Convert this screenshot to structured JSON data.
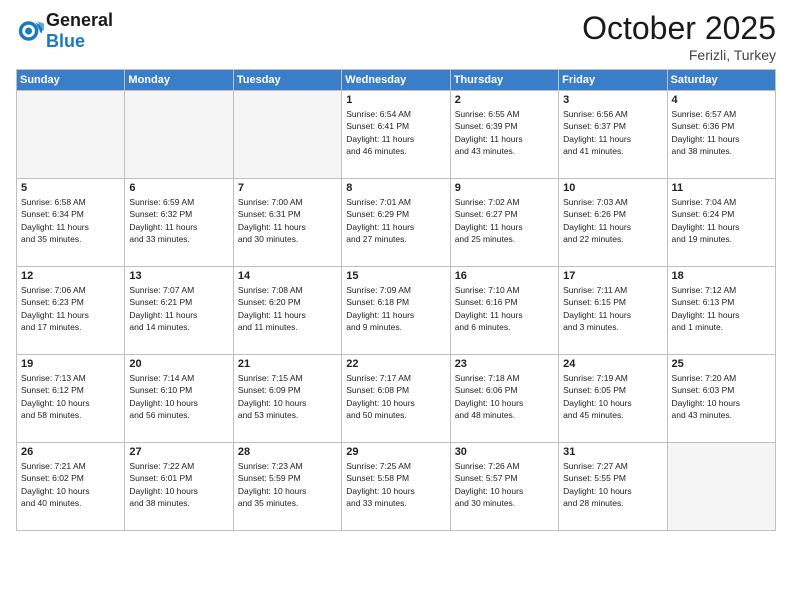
{
  "header": {
    "logo_general": "General",
    "logo_blue": "Blue",
    "month": "October 2025",
    "location": "Ferizli, Turkey"
  },
  "weekdays": [
    "Sunday",
    "Monday",
    "Tuesday",
    "Wednesday",
    "Thursday",
    "Friday",
    "Saturday"
  ],
  "weeks": [
    [
      {
        "day": "",
        "info": "",
        "empty": true
      },
      {
        "day": "",
        "info": "",
        "empty": true
      },
      {
        "day": "",
        "info": "",
        "empty": true
      },
      {
        "day": "1",
        "info": "Sunrise: 6:54 AM\nSunset: 6:41 PM\nDaylight: 11 hours\nand 46 minutes.",
        "empty": false
      },
      {
        "day": "2",
        "info": "Sunrise: 6:55 AM\nSunset: 6:39 PM\nDaylight: 11 hours\nand 43 minutes.",
        "empty": false
      },
      {
        "day": "3",
        "info": "Sunrise: 6:56 AM\nSunset: 6:37 PM\nDaylight: 11 hours\nand 41 minutes.",
        "empty": false
      },
      {
        "day": "4",
        "info": "Sunrise: 6:57 AM\nSunset: 6:36 PM\nDaylight: 11 hours\nand 38 minutes.",
        "empty": false
      }
    ],
    [
      {
        "day": "5",
        "info": "Sunrise: 6:58 AM\nSunset: 6:34 PM\nDaylight: 11 hours\nand 35 minutes.",
        "empty": false
      },
      {
        "day": "6",
        "info": "Sunrise: 6:59 AM\nSunset: 6:32 PM\nDaylight: 11 hours\nand 33 minutes.",
        "empty": false
      },
      {
        "day": "7",
        "info": "Sunrise: 7:00 AM\nSunset: 6:31 PM\nDaylight: 11 hours\nand 30 minutes.",
        "empty": false
      },
      {
        "day": "8",
        "info": "Sunrise: 7:01 AM\nSunset: 6:29 PM\nDaylight: 11 hours\nand 27 minutes.",
        "empty": false
      },
      {
        "day": "9",
        "info": "Sunrise: 7:02 AM\nSunset: 6:27 PM\nDaylight: 11 hours\nand 25 minutes.",
        "empty": false
      },
      {
        "day": "10",
        "info": "Sunrise: 7:03 AM\nSunset: 6:26 PM\nDaylight: 11 hours\nand 22 minutes.",
        "empty": false
      },
      {
        "day": "11",
        "info": "Sunrise: 7:04 AM\nSunset: 6:24 PM\nDaylight: 11 hours\nand 19 minutes.",
        "empty": false
      }
    ],
    [
      {
        "day": "12",
        "info": "Sunrise: 7:06 AM\nSunset: 6:23 PM\nDaylight: 11 hours\nand 17 minutes.",
        "empty": false
      },
      {
        "day": "13",
        "info": "Sunrise: 7:07 AM\nSunset: 6:21 PM\nDaylight: 11 hours\nand 14 minutes.",
        "empty": false
      },
      {
        "day": "14",
        "info": "Sunrise: 7:08 AM\nSunset: 6:20 PM\nDaylight: 11 hours\nand 11 minutes.",
        "empty": false
      },
      {
        "day": "15",
        "info": "Sunrise: 7:09 AM\nSunset: 6:18 PM\nDaylight: 11 hours\nand 9 minutes.",
        "empty": false
      },
      {
        "day": "16",
        "info": "Sunrise: 7:10 AM\nSunset: 6:16 PM\nDaylight: 11 hours\nand 6 minutes.",
        "empty": false
      },
      {
        "day": "17",
        "info": "Sunrise: 7:11 AM\nSunset: 6:15 PM\nDaylight: 11 hours\nand 3 minutes.",
        "empty": false
      },
      {
        "day": "18",
        "info": "Sunrise: 7:12 AM\nSunset: 6:13 PM\nDaylight: 11 hours\nand 1 minute.",
        "empty": false
      }
    ],
    [
      {
        "day": "19",
        "info": "Sunrise: 7:13 AM\nSunset: 6:12 PM\nDaylight: 10 hours\nand 58 minutes.",
        "empty": false
      },
      {
        "day": "20",
        "info": "Sunrise: 7:14 AM\nSunset: 6:10 PM\nDaylight: 10 hours\nand 56 minutes.",
        "empty": false
      },
      {
        "day": "21",
        "info": "Sunrise: 7:15 AM\nSunset: 6:09 PM\nDaylight: 10 hours\nand 53 minutes.",
        "empty": false
      },
      {
        "day": "22",
        "info": "Sunrise: 7:17 AM\nSunset: 6:08 PM\nDaylight: 10 hours\nand 50 minutes.",
        "empty": false
      },
      {
        "day": "23",
        "info": "Sunrise: 7:18 AM\nSunset: 6:06 PM\nDaylight: 10 hours\nand 48 minutes.",
        "empty": false
      },
      {
        "day": "24",
        "info": "Sunrise: 7:19 AM\nSunset: 6:05 PM\nDaylight: 10 hours\nand 45 minutes.",
        "empty": false
      },
      {
        "day": "25",
        "info": "Sunrise: 7:20 AM\nSunset: 6:03 PM\nDaylight: 10 hours\nand 43 minutes.",
        "empty": false
      }
    ],
    [
      {
        "day": "26",
        "info": "Sunrise: 7:21 AM\nSunset: 6:02 PM\nDaylight: 10 hours\nand 40 minutes.",
        "empty": false
      },
      {
        "day": "27",
        "info": "Sunrise: 7:22 AM\nSunset: 6:01 PM\nDaylight: 10 hours\nand 38 minutes.",
        "empty": false
      },
      {
        "day": "28",
        "info": "Sunrise: 7:23 AM\nSunset: 5:59 PM\nDaylight: 10 hours\nand 35 minutes.",
        "empty": false
      },
      {
        "day": "29",
        "info": "Sunrise: 7:25 AM\nSunset: 5:58 PM\nDaylight: 10 hours\nand 33 minutes.",
        "empty": false
      },
      {
        "day": "30",
        "info": "Sunrise: 7:26 AM\nSunset: 5:57 PM\nDaylight: 10 hours\nand 30 minutes.",
        "empty": false
      },
      {
        "day": "31",
        "info": "Sunrise: 7:27 AM\nSunset: 5:55 PM\nDaylight: 10 hours\nand 28 minutes.",
        "empty": false
      },
      {
        "day": "",
        "info": "",
        "empty": true
      }
    ]
  ]
}
